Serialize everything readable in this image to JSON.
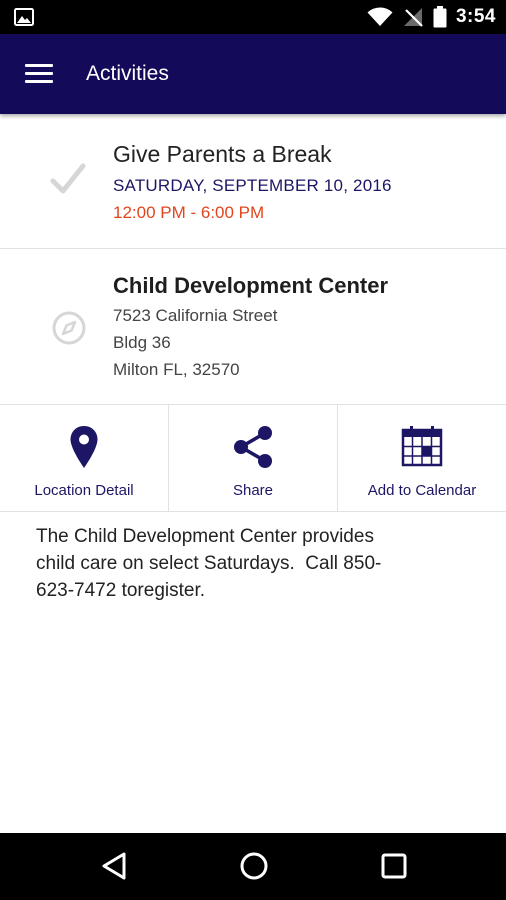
{
  "status_bar": {
    "time": "3:54"
  },
  "app_bar": {
    "title": "Activities"
  },
  "event": {
    "title": "Give Parents a Break",
    "date": "SATURDAY, SEPTEMBER 10, 2016",
    "time": "12:00 PM - 6:00 PM"
  },
  "location": {
    "name": "Child Development Center",
    "street": "7523 California Street",
    "building": "Bldg 36",
    "city": "Milton FL, 32570"
  },
  "actions": [
    {
      "label": "Location Detail",
      "icon": "map-pin-icon"
    },
    {
      "label": "Share",
      "icon": "share-icon"
    },
    {
      "label": "Add to Calendar",
      "icon": "calendar-icon"
    }
  ],
  "description": "The Child Development Center provides\nchild care on select Saturdays.  Call 850-\n623-7472 toregister.",
  "colors": {
    "app_bar": "#130a5a",
    "accent": "#1c1664",
    "time_red": "#e2451c"
  }
}
